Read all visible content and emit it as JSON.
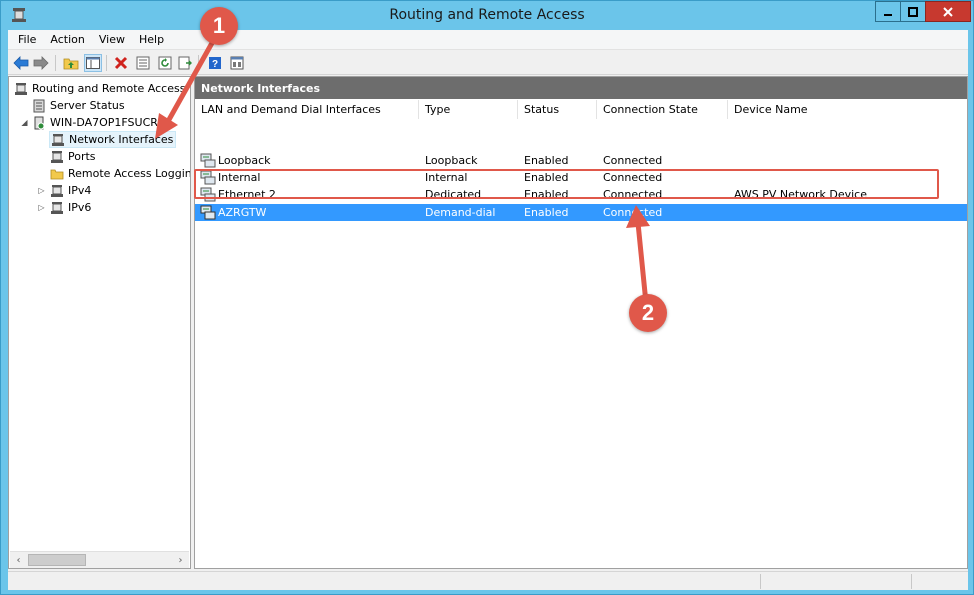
{
  "window": {
    "title": "Routing and Remote Access"
  },
  "menu": {
    "items": [
      "File",
      "Action",
      "View",
      "Help"
    ]
  },
  "toolbar": {
    "icons": [
      "back-icon",
      "forward-icon",
      "folder-up-icon",
      "show-hide-tree-icon",
      "delete-icon",
      "properties-icon",
      "refresh-icon",
      "export-list-icon",
      "help-icon",
      "console-view-icon"
    ]
  },
  "tree": {
    "root": "Routing and Remote Access",
    "server_status": "Server Status",
    "server": "WIN-DA7OP1FSUCR",
    "network_interfaces": "Network Interfaces",
    "ports": "Ports",
    "remote_access_logging": "Remote Access Logging",
    "ipv4": "IPv4",
    "ipv6": "IPv6"
  },
  "pane": {
    "header": "Network Interfaces",
    "columns": [
      "LAN and Demand Dial Interfaces",
      "Type",
      "Status",
      "Connection State",
      "Device Name"
    ],
    "rows": [
      {
        "name": "Loopback",
        "type": "Loopback",
        "status": "Enabled",
        "state": "Connected",
        "device": ""
      },
      {
        "name": "Internal",
        "type": "Internal",
        "status": "Enabled",
        "state": "Connected",
        "device": ""
      },
      {
        "name": "Ethernet 2",
        "type": "Dedicated",
        "status": "Enabled",
        "state": "Connected",
        "device": "AWS PV Network Device"
      },
      {
        "name": "AZRGTW",
        "type": "Demand-dial",
        "status": "Enabled",
        "state": "Connected",
        "device": ""
      }
    ],
    "selected_row": "AZRGTW"
  },
  "annotations": {
    "callout_1": "1",
    "callout_2": "2",
    "accent_color": "#e0584a"
  },
  "colors": {
    "titlebar": "#6bc5ea",
    "selection": "#3399ff",
    "pane_header": "#6d6d6d"
  }
}
